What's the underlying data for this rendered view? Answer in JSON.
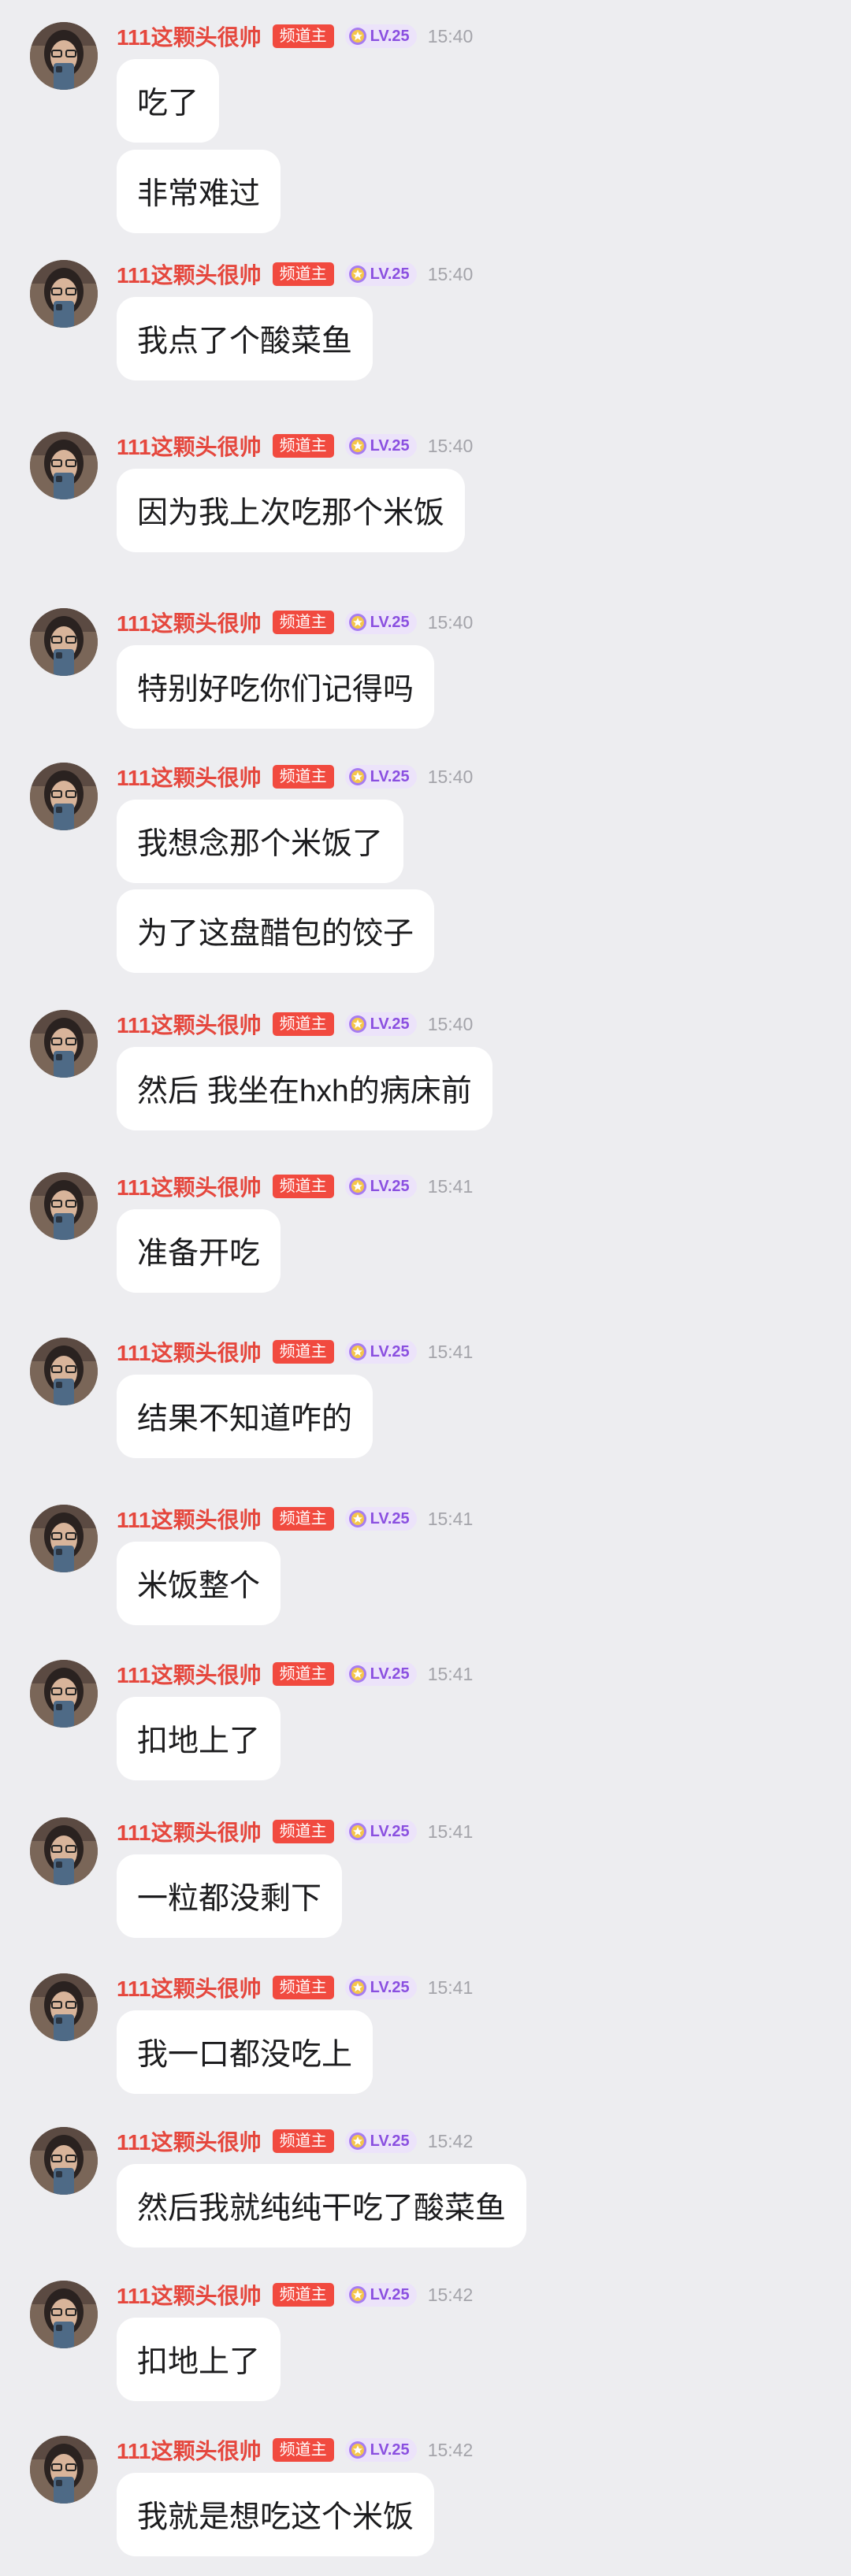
{
  "user": {
    "name": "111这颗头很帅",
    "role_badge": "频道主",
    "level": "LV.25"
  },
  "colors": {
    "background": "#ededf0",
    "username": "#e5473d",
    "role_badge_bg": "#f14a3f",
    "level_text": "#8a4fe0",
    "level_bg": "#ece3fa",
    "timestamp": "#a4a4aa",
    "bubble_bg": "#ffffff"
  },
  "icons": {
    "avatar": "user-avatar-photo",
    "level": "level-star-icon"
  },
  "messages": [
    {
      "time": "15:40",
      "bubbles": [
        "吃了",
        "非常难过"
      ]
    },
    {
      "time": "15:40",
      "bubbles": [
        "我点了个酸菜鱼"
      ]
    },
    {
      "time": "15:40",
      "bubbles": [
        "因为我上次吃那个米饭"
      ]
    },
    {
      "time": "15:40",
      "bubbles": [
        "特别好吃你们记得吗"
      ]
    },
    {
      "time": "15:40",
      "bubbles": [
        "我想念那个米饭了",
        "为了这盘醋包的饺子"
      ]
    },
    {
      "time": "15:40",
      "bubbles": [
        "然后 我坐在hxh的病床前"
      ]
    },
    {
      "time": "15:41",
      "bubbles": [
        "准备开吃"
      ]
    },
    {
      "time": "15:41",
      "bubbles": [
        "结果不知道咋的"
      ]
    },
    {
      "time": "15:41",
      "bubbles": [
        "米饭整个"
      ]
    },
    {
      "time": "15:41",
      "bubbles": [
        "扣地上了"
      ]
    },
    {
      "time": "15:41",
      "bubbles": [
        "一粒都没剩下"
      ]
    },
    {
      "time": "15:41",
      "bubbles": [
        "我一口都没吃上"
      ]
    },
    {
      "time": "15:42",
      "bubbles": [
        "然后我就纯纯干吃了酸菜鱼"
      ]
    },
    {
      "time": "15:42",
      "bubbles": [
        "扣地上了"
      ]
    },
    {
      "time": "15:42",
      "bubbles": [
        "我就是想吃这个米饭"
      ]
    }
  ]
}
